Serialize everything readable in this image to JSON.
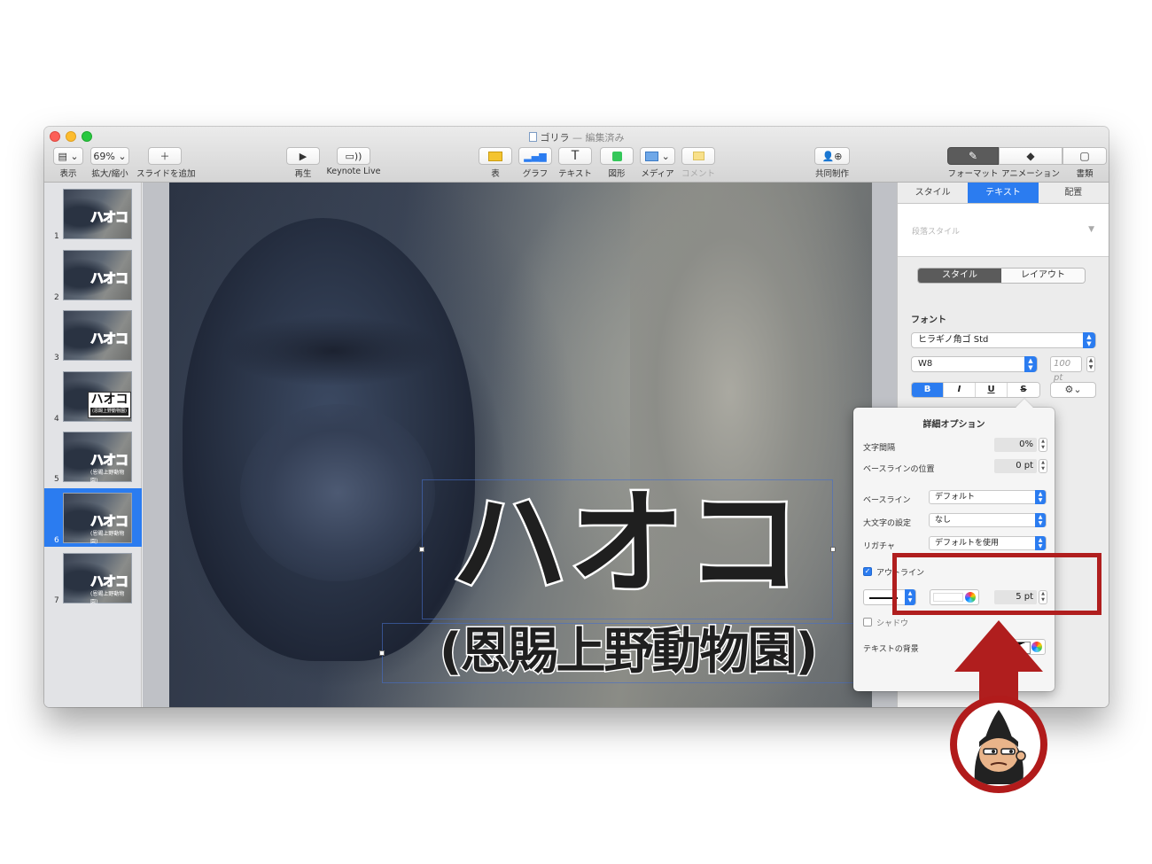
{
  "window": {
    "title": "ゴリラ",
    "title_suffix": "— 編集済み"
  },
  "toolbar": {
    "view_label": "表示",
    "zoom_value": "69%",
    "zoom_label": "拡大/縮小",
    "add_slide_label": "スライドを追加",
    "play_label": "再生",
    "keynote_live_label": "Keynote Live",
    "table_label": "表",
    "chart_label": "グラフ",
    "text_label": "テキスト",
    "shape_label": "図形",
    "media_label": "メディア",
    "comment_label": "コメント",
    "collaborate_label": "共同制作",
    "format_label": "フォーマット",
    "animate_label": "アニメーション",
    "document_label": "書類"
  },
  "navigator": {
    "slides": [
      {
        "num": "1",
        "title": "ハオコ",
        "sub": ""
      },
      {
        "num": "2",
        "title": "ハオコ",
        "sub": ""
      },
      {
        "num": "3",
        "title": "ハオコ",
        "sub": ""
      },
      {
        "num": "4",
        "title": "ハオコ",
        "sub": "(恩賜上野動物園)"
      },
      {
        "num": "5",
        "title": "ハオコ",
        "sub": "(恩賜上野動物園)"
      },
      {
        "num": "6",
        "title": "ハオコ",
        "sub": "(恩賜上野動物園)"
      },
      {
        "num": "7",
        "title": "ハオコ",
        "sub": "(恩賜上野動物園)"
      }
    ],
    "selected_index": 5
  },
  "slide": {
    "title": "ハオコ",
    "subtitle": "(恩賜上野動物園)"
  },
  "inspector": {
    "tabs": [
      "スタイル",
      "テキスト",
      "配置"
    ],
    "active_tab": "テキスト",
    "paragraph_style_placeholder": "段落スタイル",
    "style_layout_tabs": [
      "スタイル",
      "レイアウト"
    ],
    "font_header": "フォント",
    "font_family": "ヒラギノ角ゴ Std",
    "font_weight": "W8",
    "font_size": "100 pt",
    "format_buttons": [
      "B",
      "I",
      "U",
      "S"
    ]
  },
  "advanced_options": {
    "title": "詳細オプション",
    "char_spacing_label": "文字間隔",
    "char_spacing_value": "0%",
    "baseline_shift_label": "ベースラインの位置",
    "baseline_shift_value": "0 pt",
    "baseline_label": "ベースライン",
    "baseline_value": "デフォルト",
    "capitalization_label": "大文字の設定",
    "capitalization_value": "なし",
    "ligatures_label": "リガチャ",
    "ligatures_value": "デフォルトを使用",
    "outline_label": "アウトライン",
    "outline_checked": true,
    "outline_width": "5 pt",
    "outline_color": "#ffffff",
    "shadow_label": "シャドウ",
    "shadow_checked": false,
    "text_background_label": "テキストの背景"
  },
  "colors": {
    "accent": "#2b7cf0",
    "highlight": "#b01e1e"
  }
}
